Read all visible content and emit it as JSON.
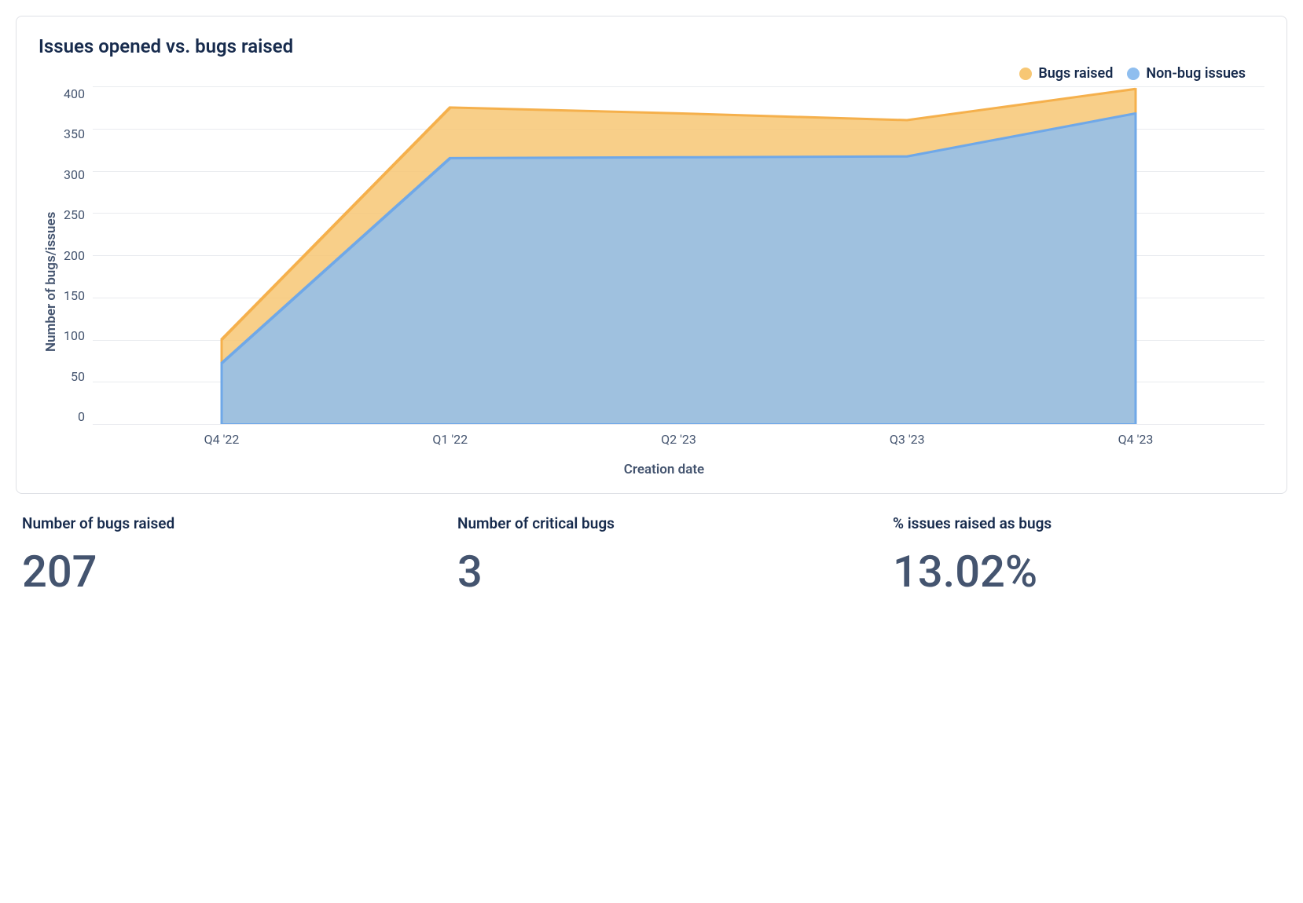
{
  "chart_data": {
    "type": "area",
    "title": "Issues opened vs. bugs raised",
    "xlabel": "Creation date",
    "ylabel": "Number of bugs/issues",
    "categories": [
      "Q4 '22",
      "Q1 '22",
      "Q2 '23",
      "Q3 '23",
      "Q4 '23"
    ],
    "series": [
      {
        "name": "Bugs raised",
        "color": "#F5B04C",
        "fill": "#F7C774",
        "values": [
          100,
          375,
          368,
          360,
          397
        ]
      },
      {
        "name": "Non-bug issues",
        "color": "#6FA8E8",
        "fill": "#8FBEEF",
        "values": [
          72,
          315,
          316,
          317,
          368
        ]
      }
    ],
    "ylim": [
      0,
      400
    ],
    "yticks": [
      0,
      50,
      100,
      150,
      200,
      250,
      300,
      350,
      400
    ],
    "legend_position": "top-right",
    "grid": true,
    "x_inset_fraction": 0.11
  },
  "stats": [
    {
      "label": "Number of bugs raised",
      "value": "207"
    },
    {
      "label": "Number of critical bugs",
      "value": "3"
    },
    {
      "label": "% issues raised as bugs",
      "value": "13.02%"
    }
  ]
}
